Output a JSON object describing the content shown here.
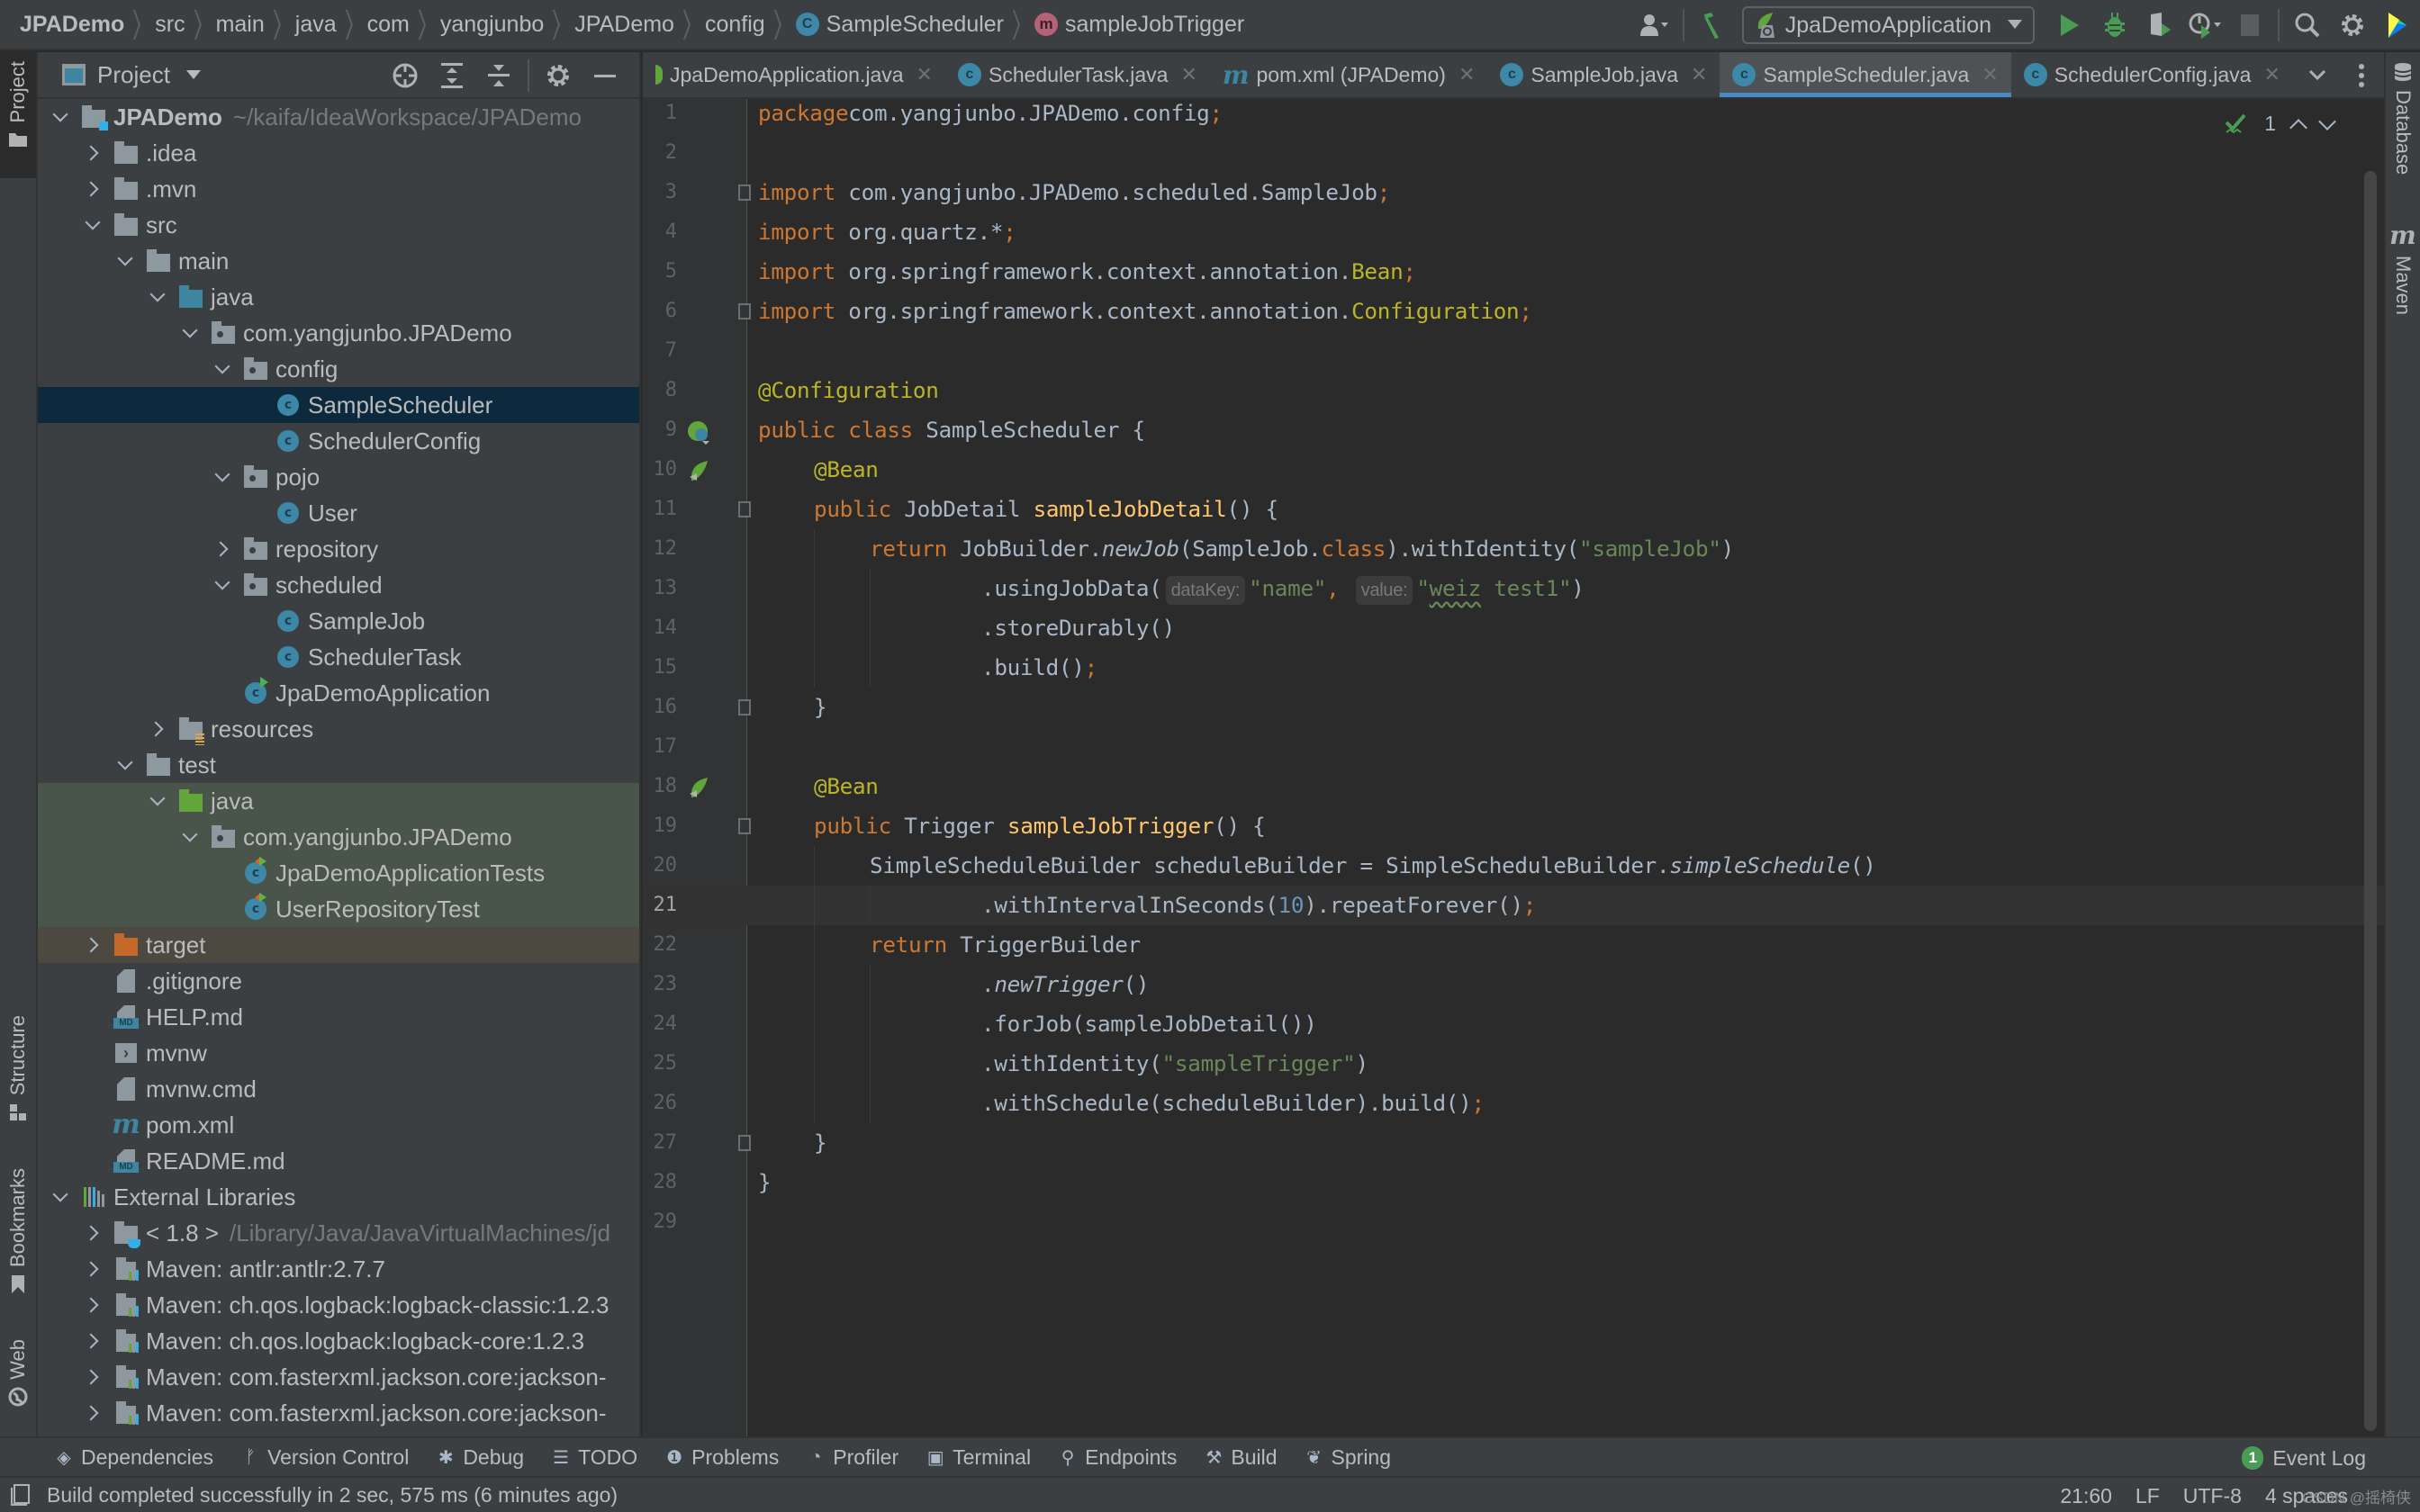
{
  "breadcrumb": {
    "items": [
      "JPADemo",
      "src",
      "main",
      "java",
      "com",
      "yangjunbo",
      "JPADemo",
      "config"
    ],
    "class_item": "SampleScheduler",
    "method_item": "sampleJobTrigger",
    "class_badge": "C",
    "method_badge": "m"
  },
  "toolbar": {
    "run_config": "JpaDemoApplication",
    "icons": [
      "user-account-icon",
      "build-hammer-icon",
      "run-icon",
      "debug-icon",
      "coverage-icon",
      "profile-icon",
      "stop-icon",
      "search-icon",
      "settings-gear-icon",
      "toolbox-icon"
    ]
  },
  "left_stripe": {
    "project": "Project",
    "structure": "Structure",
    "bookmarks": "Bookmarks",
    "web": "Web"
  },
  "right_stripe": {
    "database": "Database",
    "maven": "Maven"
  },
  "project_panel": {
    "title": "Project",
    "tree": [
      {
        "label": "JPADemo",
        "path": "~/kaifa/IdeaWorkspace/JPADemo",
        "depth": 0,
        "arrow": "down",
        "icon": "module-folder",
        "bold": true
      },
      {
        "label": ".idea",
        "depth": 1,
        "arrow": "right",
        "icon": "folder"
      },
      {
        "label": ".mvn",
        "depth": 1,
        "arrow": "right",
        "icon": "folder"
      },
      {
        "label": "src",
        "depth": 1,
        "arrow": "down",
        "icon": "folder"
      },
      {
        "label": "main",
        "depth": 2,
        "arrow": "down",
        "icon": "folder"
      },
      {
        "label": "java",
        "depth": 3,
        "arrow": "down",
        "icon": "source-folder"
      },
      {
        "label": "com.yangjunbo.JPADemo",
        "depth": 4,
        "arrow": "down",
        "icon": "package"
      },
      {
        "label": "config",
        "depth": 5,
        "arrow": "down",
        "icon": "package"
      },
      {
        "label": "SampleScheduler",
        "depth": 6,
        "arrow": "none",
        "icon": "class",
        "selected": true
      },
      {
        "label": "SchedulerConfig",
        "depth": 6,
        "arrow": "none",
        "icon": "class"
      },
      {
        "label": "pojo",
        "depth": 5,
        "arrow": "down",
        "icon": "package"
      },
      {
        "label": "User",
        "depth": 6,
        "arrow": "none",
        "icon": "class"
      },
      {
        "label": "repository",
        "depth": 5,
        "arrow": "right",
        "icon": "package"
      },
      {
        "label": "scheduled",
        "depth": 5,
        "arrow": "down",
        "icon": "package"
      },
      {
        "label": "SampleJob",
        "depth": 6,
        "arrow": "none",
        "icon": "class"
      },
      {
        "label": "SchedulerTask",
        "depth": 6,
        "arrow": "none",
        "icon": "class"
      },
      {
        "label": "JpaDemoApplication",
        "depth": 5,
        "arrow": "none",
        "icon": "spring-boot-class"
      },
      {
        "label": "resources",
        "depth": 3,
        "arrow": "right",
        "icon": "resources-folder"
      },
      {
        "label": "test",
        "depth": 2,
        "arrow": "down",
        "icon": "folder"
      },
      {
        "label": "java",
        "depth": 3,
        "arrow": "down",
        "icon": "test-folder",
        "bg": "test"
      },
      {
        "label": "com.yangjunbo.JPADemo",
        "depth": 4,
        "arrow": "down",
        "icon": "package",
        "bg": "test"
      },
      {
        "label": "JpaDemoApplicationTests",
        "depth": 5,
        "arrow": "none",
        "icon": "test-class",
        "bg": "test"
      },
      {
        "label": "UserRepositoryTest",
        "depth": 5,
        "arrow": "none",
        "icon": "test-class",
        "bg": "test"
      },
      {
        "label": "target",
        "depth": 1,
        "arrow": "right",
        "icon": "excluded-folder",
        "bg": "target"
      },
      {
        "label": ".gitignore",
        "depth": 1,
        "arrow": "none",
        "icon": "ignore-file"
      },
      {
        "label": "HELP.md",
        "depth": 1,
        "arrow": "none",
        "icon": "markdown-file"
      },
      {
        "label": "mvnw",
        "depth": 1,
        "arrow": "none",
        "icon": "shell-file"
      },
      {
        "label": "mvnw.cmd",
        "depth": 1,
        "arrow": "none",
        "icon": "text-file"
      },
      {
        "label": "pom.xml",
        "depth": 1,
        "arrow": "none",
        "icon": "maven-file"
      },
      {
        "label": "README.md",
        "depth": 1,
        "arrow": "none",
        "icon": "markdown-file"
      },
      {
        "label": "External Libraries",
        "depth": 0,
        "arrow": "down",
        "icon": "libraries"
      },
      {
        "label": "< 1.8 >",
        "path": "/Library/Java/JavaVirtualMachines/jd",
        "depth": 1,
        "arrow": "right",
        "icon": "jdk-folder"
      },
      {
        "label": "Maven: antlr:antlr:2.7.7",
        "depth": 1,
        "arrow": "right",
        "icon": "library"
      },
      {
        "label": "Maven: ch.qos.logback:logback-classic:1.2.3",
        "depth": 1,
        "arrow": "right",
        "icon": "library"
      },
      {
        "label": "Maven: ch.qos.logback:logback-core:1.2.3",
        "depth": 1,
        "arrow": "right",
        "icon": "library"
      },
      {
        "label": "Maven: com.fasterxml.jackson.core:jackson-",
        "depth": 1,
        "arrow": "right",
        "icon": "library"
      },
      {
        "label": "Maven: com.fasterxml.jackson.core:jackson-",
        "depth": 1,
        "arrow": "right",
        "icon": "library"
      }
    ]
  },
  "editor_tabs": [
    {
      "label": "JpaDemoApplication.java",
      "icon": "spring-boot-class",
      "active": false
    },
    {
      "label": "SchedulerTask.java",
      "icon": "class",
      "active": false
    },
    {
      "label": "pom.xml (JPADemo)",
      "icon": "maven",
      "active": false
    },
    {
      "label": "SampleJob.java",
      "icon": "class",
      "active": false
    },
    {
      "label": "SampleScheduler.java",
      "icon": "class",
      "active": true
    },
    {
      "label": "SchedulerConfig.java",
      "icon": "class",
      "active": false
    }
  ],
  "editor": {
    "current_line": 21,
    "inspection_count": "1",
    "lines": [
      {
        "n": 1,
        "indent": 0,
        "tokens": [
          [
            "kw",
            "package"
          ],
          [
            "",
            "com.yangjunbo.JPADemo.config"
          ],
          [
            "kw",
            ";"
          ]
        ]
      },
      {
        "n": 2,
        "indent": 0,
        "tokens": []
      },
      {
        "n": 3,
        "indent": 0,
        "fold": true,
        "tokens": [
          [
            "kw",
            "import "
          ],
          [
            "",
            "com.yangjunbo.JPADemo.scheduled.SampleJob"
          ],
          [
            "kw",
            ";"
          ]
        ]
      },
      {
        "n": 4,
        "indent": 0,
        "tokens": [
          [
            "kw",
            "import "
          ],
          [
            "",
            "org.quartz.*"
          ],
          [
            "kw",
            ";"
          ]
        ]
      },
      {
        "n": 5,
        "indent": 0,
        "tokens": [
          [
            "kw",
            "import "
          ],
          [
            "",
            "org.springframework.context.annotation."
          ],
          [
            "ann",
            "Bean"
          ],
          [
            "kw",
            ";"
          ]
        ]
      },
      {
        "n": 6,
        "indent": 0,
        "fold": true,
        "tokens": [
          [
            "kw",
            "import "
          ],
          [
            "",
            "org.springframework.context.annotation."
          ],
          [
            "ann",
            "Configuration"
          ],
          [
            "kw",
            ";"
          ]
        ]
      },
      {
        "n": 7,
        "indent": 0,
        "tokens": []
      },
      {
        "n": 8,
        "indent": 0,
        "tokens": [
          [
            "ann",
            "@Configuration"
          ]
        ]
      },
      {
        "n": 9,
        "indent": 0,
        "gutter": "spring-bean-class",
        "tokens": [
          [
            "kw",
            "public class "
          ],
          [
            "",
            "SampleScheduler {"
          ]
        ]
      },
      {
        "n": 10,
        "indent": 1,
        "gutter": "spring-bean-method",
        "tokens": [
          [
            "ann",
            "@Bean"
          ]
        ]
      },
      {
        "n": 11,
        "indent": 1,
        "fold": true,
        "tokens": [
          [
            "kw",
            "public "
          ],
          [
            "",
            "JobDetail "
          ],
          [
            "fn",
            "sampleJobDetail"
          ],
          [
            "",
            "() {"
          ]
        ]
      },
      {
        "n": 12,
        "indent": 2,
        "tokens": [
          [
            "kw",
            "return "
          ],
          [
            "",
            "JobBuilder."
          ],
          [
            "it",
            "newJob"
          ],
          [
            "",
            "(SampleJob."
          ],
          [
            "kw",
            "class"
          ],
          [
            "",
            ").withIdentity("
          ],
          [
            "str",
            "\"sampleJob\""
          ],
          [
            "",
            ")"
          ]
        ]
      },
      {
        "n": 13,
        "indent": 4,
        "tokens": [
          [
            "",
            ".usingJobData("
          ],
          [
            "hint",
            "dataKey:"
          ],
          [
            "str",
            "\"name\""
          ],
          [
            "kw",
            ", "
          ],
          [
            "hint",
            "value:"
          ],
          [
            "str",
            "\""
          ],
          [
            "squig",
            "weiz"
          ],
          [
            "str",
            " test1\""
          ],
          [
            "",
            ")"
          ]
        ]
      },
      {
        "n": 14,
        "indent": 4,
        "tokens": [
          [
            "",
            ".storeDurably()"
          ]
        ]
      },
      {
        "n": 15,
        "indent": 4,
        "tokens": [
          [
            "",
            ".build()"
          ],
          [
            "kw",
            ";"
          ]
        ]
      },
      {
        "n": 16,
        "indent": 1,
        "fold": true,
        "tokens": [
          [
            "",
            "}"
          ]
        ]
      },
      {
        "n": 17,
        "indent": 0,
        "tokens": []
      },
      {
        "n": 18,
        "indent": 1,
        "gutter": "spring-bean-method",
        "tokens": [
          [
            "ann",
            "@Bean"
          ]
        ]
      },
      {
        "n": 19,
        "indent": 1,
        "fold": true,
        "tokens": [
          [
            "kw",
            "public "
          ],
          [
            "",
            "Trigger "
          ],
          [
            "fn",
            "sampleJobTrigger"
          ],
          [
            "",
            "() {"
          ]
        ]
      },
      {
        "n": 20,
        "indent": 2,
        "tokens": [
          [
            "",
            "SimpleScheduleBuilder scheduleBuilder = SimpleScheduleBuilder."
          ],
          [
            "it",
            "simpleSchedule"
          ],
          [
            "",
            "()"
          ]
        ]
      },
      {
        "n": 21,
        "indent": 4,
        "tokens": [
          [
            "",
            ".withIntervalInSeconds("
          ],
          [
            "num",
            "10"
          ],
          [
            "",
            ").repeatForever()"
          ],
          [
            "kw",
            ";"
          ]
        ]
      },
      {
        "n": 22,
        "indent": 2,
        "tokens": [
          [
            "kw",
            "return "
          ],
          [
            "",
            "TriggerBuilder"
          ]
        ]
      },
      {
        "n": 23,
        "indent": 4,
        "tokens": [
          [
            "",
            "."
          ],
          [
            "it",
            "newTrigger"
          ],
          [
            "",
            "()"
          ]
        ]
      },
      {
        "n": 24,
        "indent": 4,
        "tokens": [
          [
            "",
            ".forJob(sampleJobDetail())"
          ]
        ]
      },
      {
        "n": 25,
        "indent": 4,
        "tokens": [
          [
            "",
            ".withIdentity("
          ],
          [
            "str",
            "\"sampleTrigger\""
          ],
          [
            "",
            ")"
          ]
        ]
      },
      {
        "n": 26,
        "indent": 4,
        "tokens": [
          [
            "",
            ".withSchedule(scheduleBuilder).build()"
          ],
          [
            "kw",
            ";"
          ]
        ]
      },
      {
        "n": 27,
        "indent": 1,
        "fold": true,
        "tokens": [
          [
            "",
            "}"
          ]
        ]
      },
      {
        "n": 28,
        "indent": 0,
        "tokens": [
          [
            "",
            "}"
          ]
        ]
      },
      {
        "n": 29,
        "indent": 0,
        "tokens": []
      }
    ]
  },
  "bottom_tools": [
    {
      "label": "Dependencies",
      "icon": "dependencies-icon",
      "glyph": "◈"
    },
    {
      "label": "Version Control",
      "icon": "version-control-icon",
      "glyph": "ᚠ"
    },
    {
      "label": "Debug",
      "icon": "debug-bug-icon",
      "glyph": "✱"
    },
    {
      "label": "TODO",
      "icon": "todo-list-icon",
      "glyph": "☰"
    },
    {
      "label": "Problems",
      "icon": "problems-icon",
      "glyph": "❶"
    },
    {
      "label": "Profiler",
      "icon": "profiler-icon",
      "glyph": "◔"
    },
    {
      "label": "Terminal",
      "icon": "terminal-icon",
      "glyph": "▣"
    },
    {
      "label": "Endpoints",
      "icon": "endpoints-icon",
      "glyph": "⚲"
    },
    {
      "label": "Build",
      "icon": "build-hammer-icon",
      "glyph": "⚒"
    },
    {
      "label": "Spring",
      "icon": "spring-leaf-icon",
      "glyph": "❦"
    }
  ],
  "event_log": {
    "label": "Event Log",
    "count": "1"
  },
  "status": {
    "message": "Build completed successfully in 2 sec, 575 ms (6 minutes ago)",
    "position": "21:60",
    "line_separator": "LF",
    "encoding": "UTF-8",
    "indent": "4 spaces",
    "watermark": "CSDN @摇椅侠"
  },
  "colors": {
    "accent": "#4a88c7",
    "selection": "#0d293e",
    "keyword": "#cc7832",
    "annotation": "#bbb529",
    "string": "#6a8759",
    "number": "#6897bb",
    "method_decl": "#ffc66d",
    "success_green": "#499c54"
  }
}
